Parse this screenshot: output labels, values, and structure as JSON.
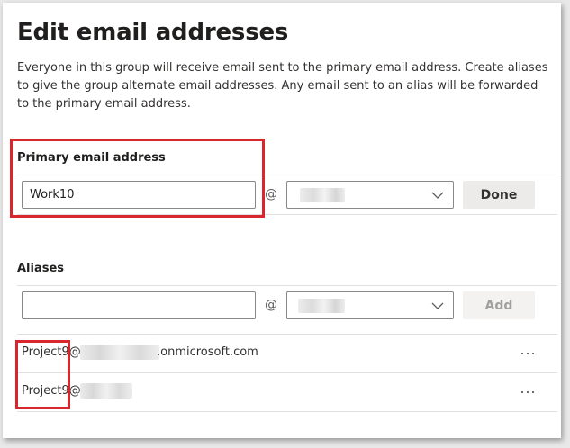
{
  "dialog": {
    "title": "Edit email addresses",
    "description": "Everyone in this group will receive email sent to the primary email address. Create aliases to give the group alternate email addresses. Any email sent to an alias will be forwarded to the primary email address."
  },
  "primary": {
    "label": "Primary email address",
    "input_value": "Work10",
    "at_symbol": "@",
    "done_label": "Done"
  },
  "aliases": {
    "label": "Aliases",
    "input_value": "",
    "at_symbol": "@",
    "add_label": "Add",
    "items": [
      {
        "prefix": "Project9@",
        "suffix": ".onmicrosoft.com"
      },
      {
        "prefix": "Project9@",
        "suffix": ""
      }
    ]
  },
  "colors": {
    "highlight": "#d9262c",
    "border": "#8a8886",
    "divider": "#e1dfdd"
  },
  "icons": {
    "chevron": "chevron-down-icon",
    "more": "more-options-icon"
  }
}
